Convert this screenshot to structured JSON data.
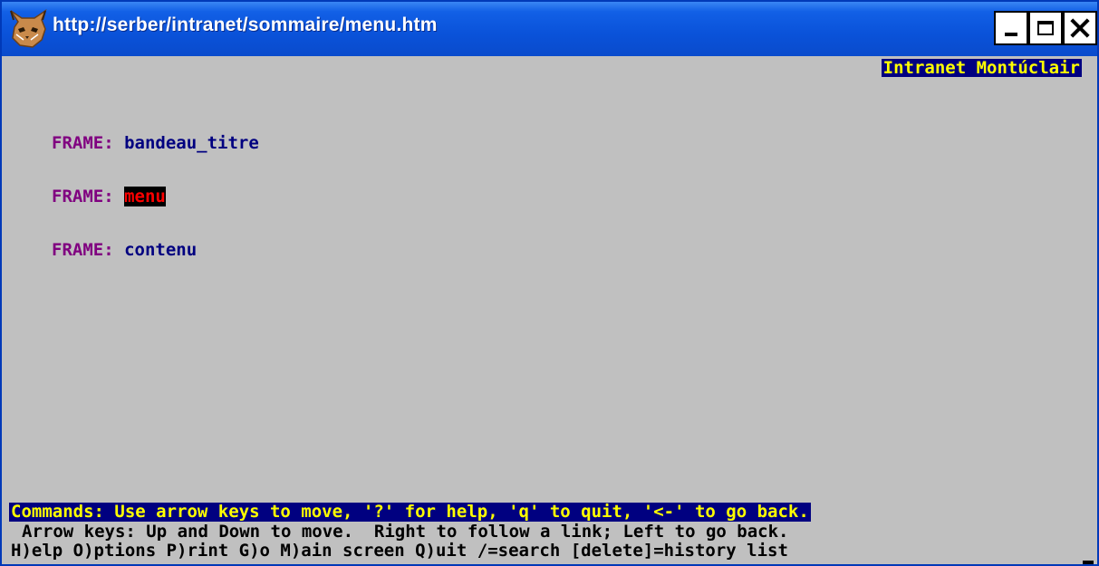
{
  "window": {
    "title": "http://serber/intranet/sommaire/menu.htm",
    "icon": "lynx-icon",
    "buttons": {
      "minimize": "minimize-icon",
      "maximize": "maximize-icon",
      "close": "close-icon"
    }
  },
  "header": {
    "site_label": "Intranet Montúclair"
  },
  "frames": [
    {
      "keyword": "FRAME:",
      "name": "bandeau_titre",
      "selected": false
    },
    {
      "keyword": "FRAME:",
      "name": "menu",
      "selected": true
    },
    {
      "keyword": "FRAME:",
      "name": "contenu",
      "selected": false
    }
  ],
  "status": {
    "commands": "Commands: Use arrow keys to move, '?' for help, 'q' to quit, '<-' to go back.",
    "help_line_1": "Arrow keys: Up and Down to move.  Right to follow a link; Left to go back.",
    "help_line_2": "H)elp O)ptions P)rint G)o M)ain screen Q)uit /=search [delete]=history list"
  },
  "colors": {
    "title_bar": "#0a4fd6",
    "background": "#c0c0c0",
    "highlight_bg": "#000080",
    "highlight_fg": "#ffff00",
    "frame_keyword": "#800080",
    "link": "#000080",
    "active_link_fg": "#ff0000",
    "active_link_bg": "#000000"
  }
}
